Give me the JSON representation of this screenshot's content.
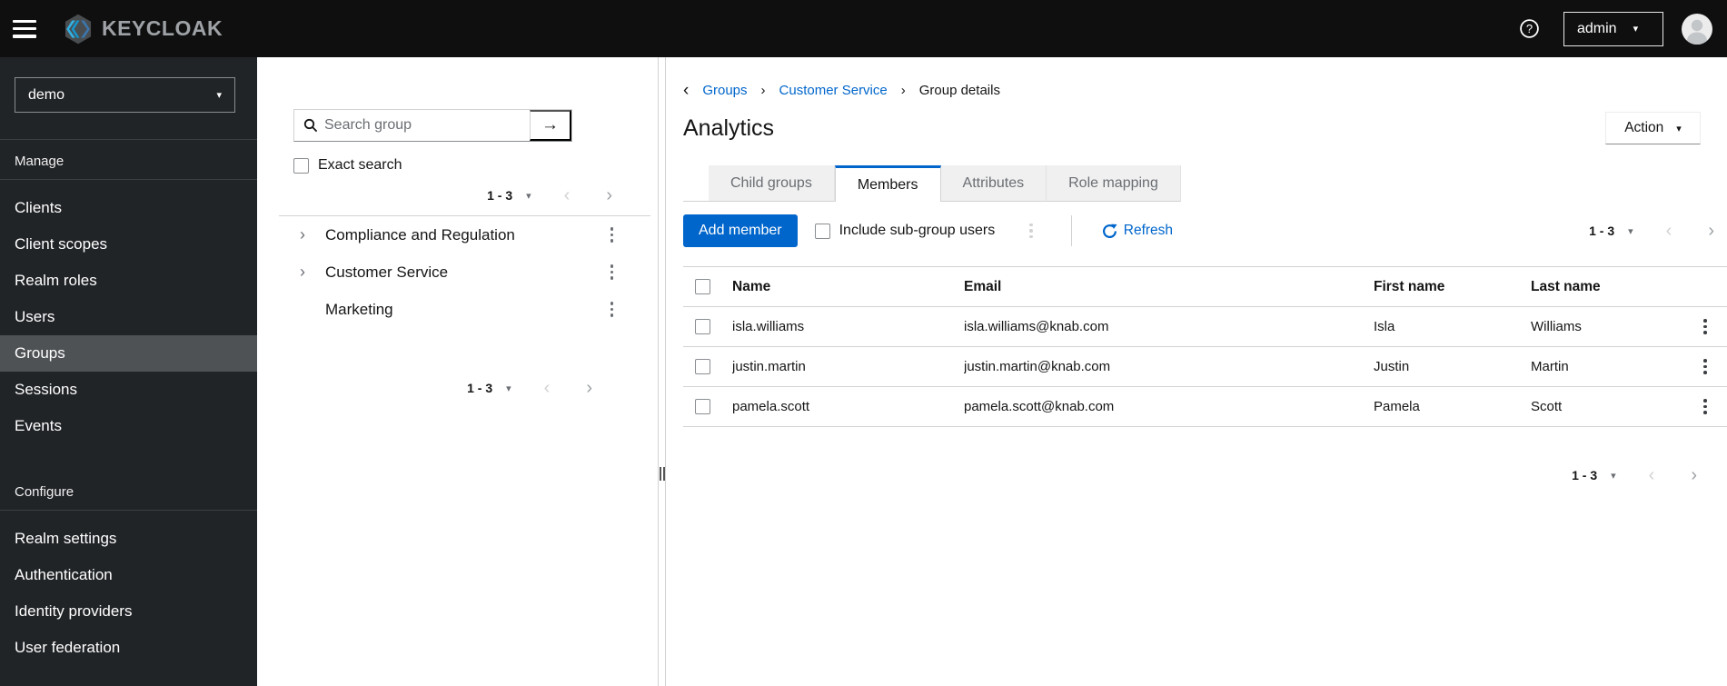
{
  "topbar": {
    "brand": "KEYCLOAK",
    "user": "admin"
  },
  "sidebar": {
    "realm": "demo",
    "sections": [
      {
        "title": "Manage",
        "items": [
          {
            "label": "Clients"
          },
          {
            "label": "Client scopes"
          },
          {
            "label": "Realm roles"
          },
          {
            "label": "Users"
          },
          {
            "label": "Groups"
          },
          {
            "label": "Sessions"
          },
          {
            "label": "Events"
          }
        ]
      },
      {
        "title": "Configure",
        "items": [
          {
            "label": "Realm settings"
          },
          {
            "label": "Authentication"
          },
          {
            "label": "Identity providers"
          },
          {
            "label": "User federation"
          }
        ]
      }
    ]
  },
  "tree": {
    "search_placeholder": "Search group",
    "search_button": "→",
    "exact_label": "Exact search",
    "pagination_top": "1 - 3",
    "pagination_bottom": "1 - 3",
    "groups": [
      {
        "label": "Compliance and Regulation"
      },
      {
        "label": "Customer Service"
      },
      {
        "label": "Marketing"
      }
    ]
  },
  "main": {
    "breadcrumb": {
      "items": [
        "Groups",
        "Customer Service"
      ],
      "current": "Group details"
    },
    "title": "Analytics",
    "action_label": "Action",
    "tabs": [
      {
        "label": "Child groups"
      },
      {
        "label": "Members"
      },
      {
        "label": "Attributes"
      },
      {
        "label": "Role mapping"
      }
    ],
    "toolbar": {
      "add_member": "Add member",
      "include_subgroups": "Include sub-group users",
      "refresh": "Refresh",
      "pagination": "1 - 3"
    },
    "table": {
      "headers": [
        "Name",
        "Email",
        "First name",
        "Last name"
      ],
      "rows": [
        {
          "name": "isla.williams",
          "email": "isla.williams@knab.com",
          "first": "Isla",
          "last": "Williams"
        },
        {
          "name": "justin.martin",
          "email": "justin.martin@knab.com",
          "first": "Justin",
          "last": "Martin"
        },
        {
          "name": "pamela.scott",
          "email": "pamela.scott@knab.com",
          "first": "Pamela",
          "last": "Scott"
        }
      ]
    },
    "pagination_bottom": "1 - 3"
  },
  "colors": {
    "accent": "#0066cc",
    "topbar_bg": "#0f0f0f",
    "sidebar_bg": "#212427",
    "sidebar_selected": "#4f5255",
    "border": "#d2d2d2",
    "muted_text": "#6a6e73",
    "tab_inactive_bg": "#f0f0f0"
  }
}
